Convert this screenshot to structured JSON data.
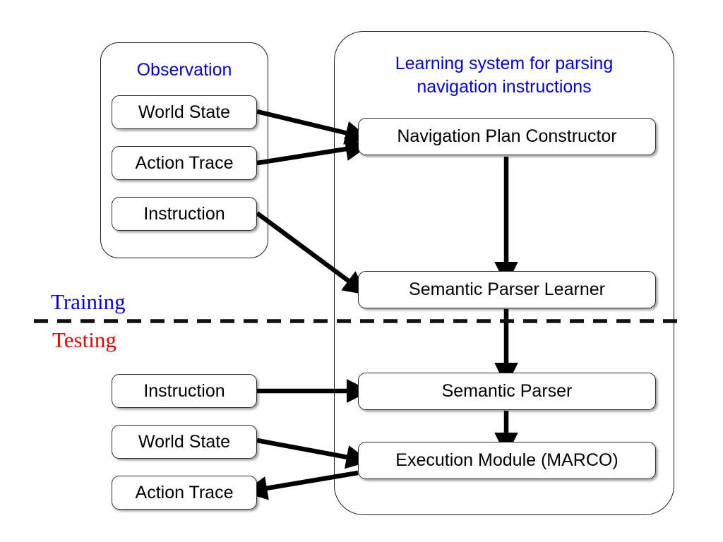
{
  "diagram": {
    "title_observation": "Observation",
    "title_learning": "Learning system for parsing\nnavigation instructions",
    "phase_training": "Training",
    "phase_testing": "Testing",
    "colors": {
      "group_title": "#0000ee",
      "training_label": "#0000ee",
      "testing_label": "#ee0000",
      "node_border": "#2a2a2a",
      "node_text": "#000000",
      "arrow": "#000000",
      "background": "#ffffff"
    },
    "nodes": {
      "train_world_state": "World State",
      "train_action_trace": "Action Trace",
      "train_instruction": "Instruction",
      "test_instruction": "Instruction",
      "test_world_state": "World State",
      "test_action_trace": "Action Trace",
      "nav_plan_constructor": "Navigation Plan Constructor",
      "semantic_parser_learner": "Semantic Parser Learner",
      "semantic_parser": "Semantic Parser",
      "execution_module": "Execution Module (MARCO)"
    },
    "edges": [
      {
        "name": "world-state-to-nav-plan-constructor",
        "from": "World State",
        "to": "Navigation Plan Constructor"
      },
      {
        "name": "action-trace-to-nav-plan-constructor",
        "from": "Action Trace",
        "to": "Navigation Plan Constructor"
      },
      {
        "name": "instruction-to-semantic-parser-learner",
        "from": "Instruction",
        "to": "Semantic Parser Learner"
      },
      {
        "name": "nav-plan-constructor-to-semantic-parser-learner",
        "from": "Navigation Plan Constructor",
        "to": "Semantic Parser Learner"
      },
      {
        "name": "semantic-parser-learner-to-semantic-parser",
        "from": "Semantic Parser Learner",
        "to": "Semantic Parser"
      },
      {
        "name": "instruction-to-semantic-parser",
        "from": "Instruction",
        "to": "Semantic Parser"
      },
      {
        "name": "semantic-parser-to-execution-module",
        "from": "Semantic Parser",
        "to": "Execution Module (MARCO)"
      },
      {
        "name": "world-state-to-execution-module",
        "from": "World State",
        "to": "Execution Module (MARCO)"
      },
      {
        "name": "execution-module-to-action-trace",
        "from": "Execution Module (MARCO)",
        "to": "Action Trace"
      }
    ],
    "divider": "dashed-horizontal-separator"
  }
}
